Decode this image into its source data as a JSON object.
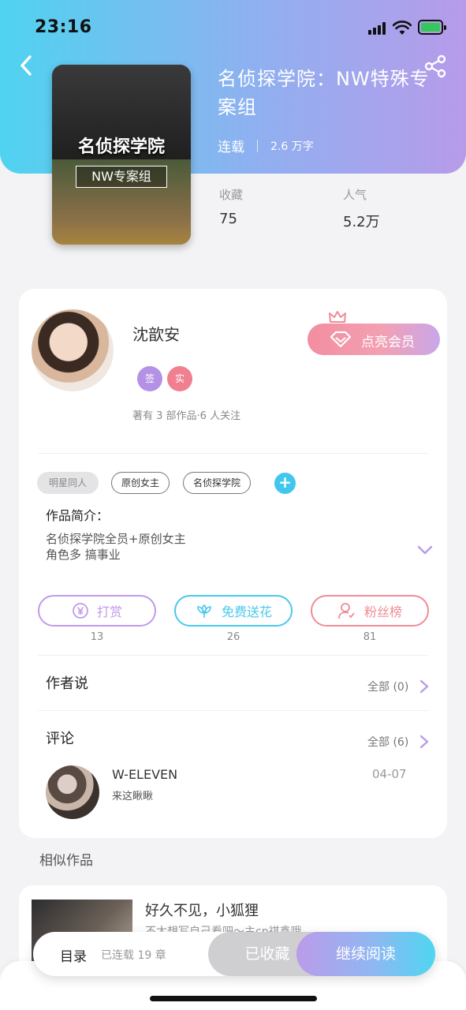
{
  "status_bar": {
    "time": "23:16"
  },
  "book": {
    "title": "名侦探学院：NW特殊专案组",
    "status": "连载",
    "words": "2.6 万字",
    "cover_title": "名侦探学院",
    "cover_subtitle": "NW专案组",
    "stats": [
      {
        "label": "收藏",
        "value": "75"
      },
      {
        "label": "人气",
        "value": "5.2万"
      }
    ]
  },
  "author": {
    "name": "沈歆安",
    "badges": [
      {
        "text": "签",
        "color": "#b591e6"
      },
      {
        "text": "实",
        "color": "#f07f8f"
      }
    ],
    "works_info": "著有 3 部作品·6 人关注",
    "member_button": "点亮会员"
  },
  "tags": [
    "明星同人",
    "原创女主",
    "名侦探学院"
  ],
  "intro": {
    "title": "作品简介：",
    "lines": [
      "名侦探学院全员+原创女主",
      "角色多 搞事业"
    ]
  },
  "actions": [
    {
      "label": "打赏",
      "count": "13",
      "color": "#c19aeb"
    },
    {
      "label": "免费送花",
      "count": "26",
      "color": "#49c9ea"
    },
    {
      "label": "粉丝榜",
      "count": "81",
      "color": "#f08c96"
    }
  ],
  "author_says": {
    "title": "作者说",
    "all": "全部 (0)"
  },
  "comments": {
    "title": "评论",
    "all": "全部 (6)",
    "items": [
      {
        "user": "W-ELEVEN",
        "text": "来这瞅瞅",
        "date": "04-07"
      }
    ]
  },
  "similar": {
    "heading": "相似作品",
    "items": [
      {
        "title": "好久不见，小狐狸",
        "desc": "不太想写自己看吧～主cp祺鑫哦"
      }
    ]
  },
  "bottom_bar": {
    "toc": "目录",
    "chapters": "已连载 19 章",
    "favorited": "已收藏",
    "continue": "继续阅读"
  }
}
